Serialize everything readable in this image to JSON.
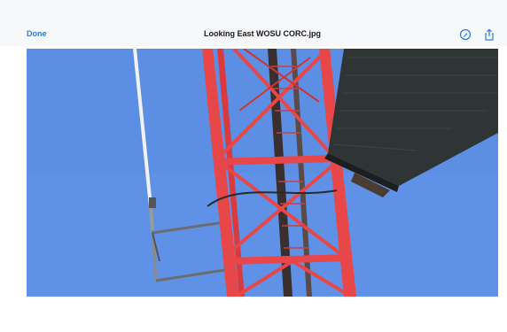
{
  "toolbar": {
    "done_label": "Done",
    "title": "Looking East WOSU CORC.jpg",
    "markup_icon": "markup-pen-circle-icon",
    "share_icon": "share-icon",
    "accent_color": "#2f7de1"
  },
  "photo": {
    "sky_color": "#5c8ee3",
    "tower_color": "#e8474a",
    "panel_color": "#2e3534"
  }
}
